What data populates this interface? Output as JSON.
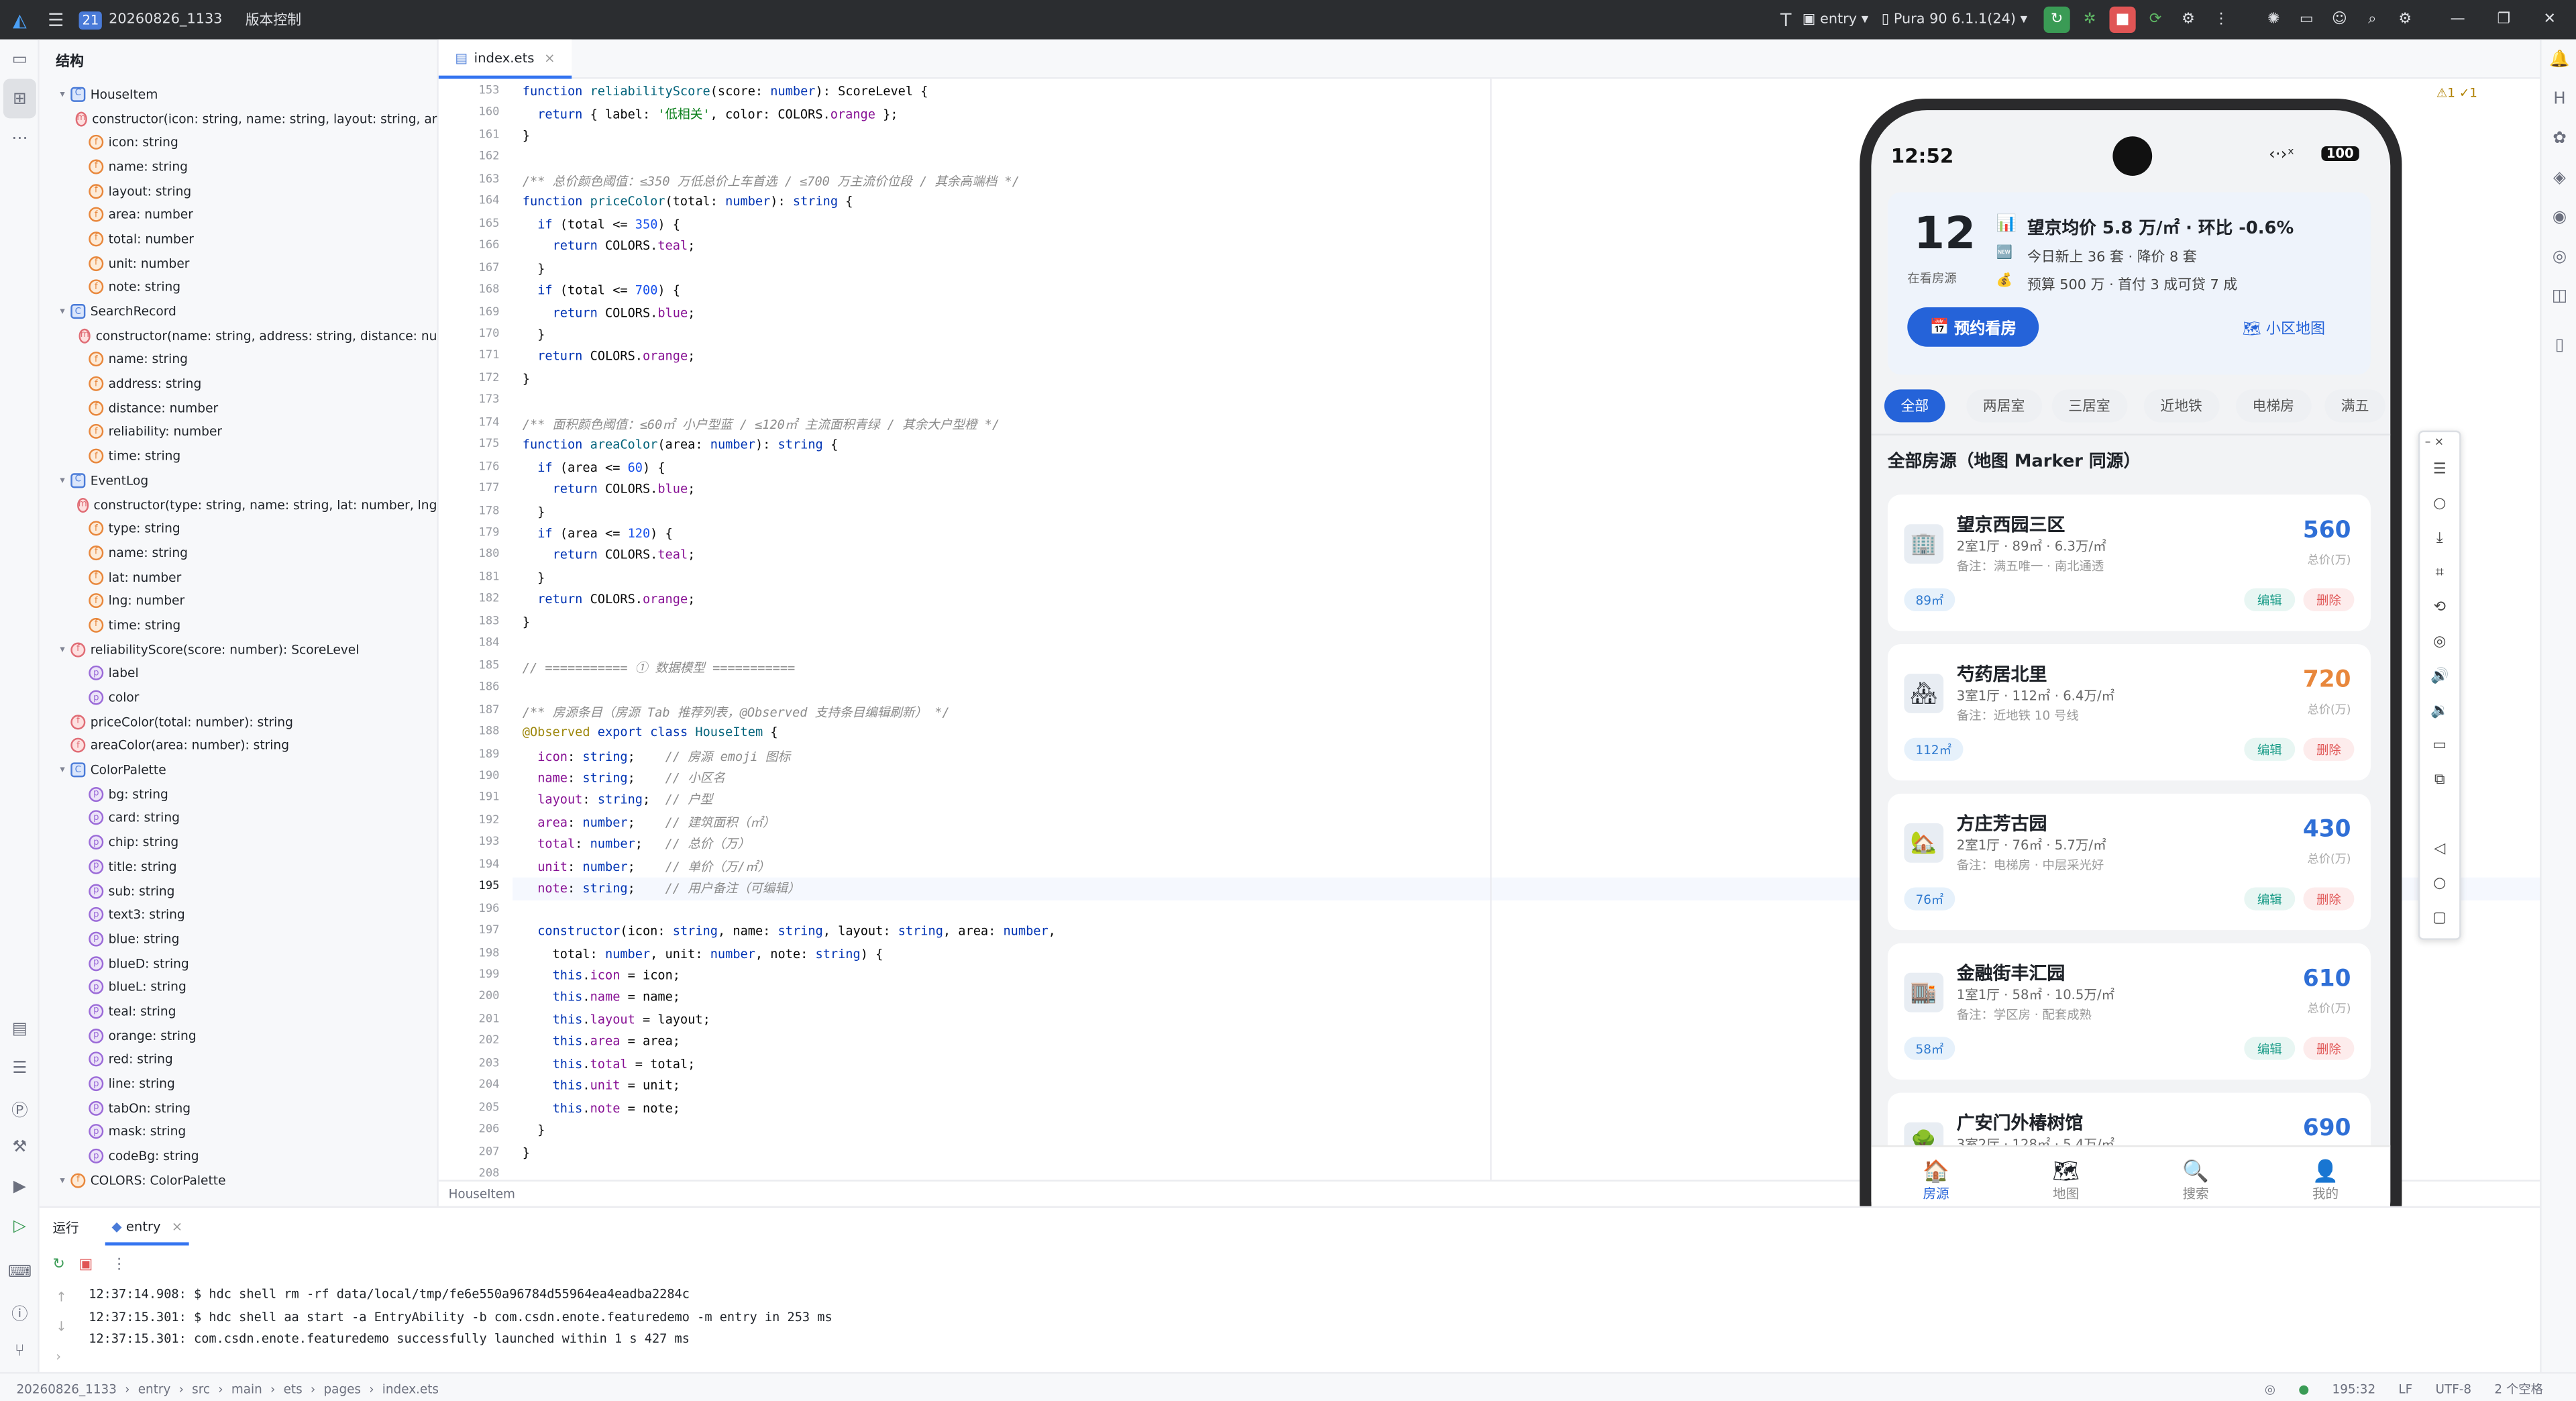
{
  "titlebar": {
    "project_badge": "21",
    "project_name": "20260826_1133",
    "vcs": "版本控制",
    "module": "entry",
    "device": "Pura 90 6.1.1(24)"
  },
  "structure": {
    "title": "结构",
    "items": [
      {
        "indent": 1,
        "twisty": "▾",
        "icon": "c",
        "label": "HouseItem"
      },
      {
        "indent": 2,
        "twisty": "",
        "icon": "m",
        "label": "constructor(icon: string, name: string, layout: string, ar"
      },
      {
        "indent": 2,
        "twisty": "",
        "icon": "f",
        "label": "icon: string"
      },
      {
        "indent": 2,
        "twisty": "",
        "icon": "f",
        "label": "name: string"
      },
      {
        "indent": 2,
        "twisty": "",
        "icon": "f",
        "label": "layout: string"
      },
      {
        "indent": 2,
        "twisty": "",
        "icon": "f",
        "label": "area: number"
      },
      {
        "indent": 2,
        "twisty": "",
        "icon": "f",
        "label": "total: number"
      },
      {
        "indent": 2,
        "twisty": "",
        "icon": "f",
        "label": "unit: number"
      },
      {
        "indent": 2,
        "twisty": "",
        "icon": "f",
        "label": "note: string"
      },
      {
        "indent": 1,
        "twisty": "▾",
        "icon": "c",
        "label": "SearchRecord"
      },
      {
        "indent": 2,
        "twisty": "",
        "icon": "m",
        "label": "constructor(name: string, address: string, distance: nu"
      },
      {
        "indent": 2,
        "twisty": "",
        "icon": "f",
        "label": "name: string"
      },
      {
        "indent": 2,
        "twisty": "",
        "icon": "f",
        "label": "address: string"
      },
      {
        "indent": 2,
        "twisty": "",
        "icon": "f",
        "label": "distance: number"
      },
      {
        "indent": 2,
        "twisty": "",
        "icon": "f",
        "label": "reliability: number"
      },
      {
        "indent": 2,
        "twisty": "",
        "icon": "f",
        "label": "time: string"
      },
      {
        "indent": 1,
        "twisty": "▾",
        "icon": "c",
        "label": "EventLog"
      },
      {
        "indent": 2,
        "twisty": "",
        "icon": "m",
        "label": "constructor(type: string, name: string, lat: number, lng"
      },
      {
        "indent": 2,
        "twisty": "",
        "icon": "f",
        "label": "type: string"
      },
      {
        "indent": 2,
        "twisty": "",
        "icon": "f",
        "label": "name: string"
      },
      {
        "indent": 2,
        "twisty": "",
        "icon": "f",
        "label": "lat: number"
      },
      {
        "indent": 2,
        "twisty": "",
        "icon": "f",
        "label": "lng: number"
      },
      {
        "indent": 2,
        "twisty": "",
        "icon": "f",
        "label": "time: string"
      },
      {
        "indent": 1,
        "twisty": "▾",
        "icon": "fn",
        "label": "reliabilityScore(score: number): ScoreLevel"
      },
      {
        "indent": 2,
        "twisty": "",
        "icon": "p",
        "label": "label"
      },
      {
        "indent": 2,
        "twisty": "",
        "icon": "p",
        "label": "color"
      },
      {
        "indent": 1,
        "twisty": "",
        "icon": "fn",
        "label": "priceColor(total: number): string"
      },
      {
        "indent": 1,
        "twisty": "",
        "icon": "fn",
        "label": "areaColor(area: number): string"
      },
      {
        "indent": 1,
        "twisty": "▾",
        "icon": "c",
        "label": "ColorPalette"
      },
      {
        "indent": 2,
        "twisty": "",
        "icon": "p",
        "label": "bg: string"
      },
      {
        "indent": 2,
        "twisty": "",
        "icon": "p",
        "label": "card: string"
      },
      {
        "indent": 2,
        "twisty": "",
        "icon": "p",
        "label": "chip: string"
      },
      {
        "indent": 2,
        "twisty": "",
        "icon": "p",
        "label": "title: string"
      },
      {
        "indent": 2,
        "twisty": "",
        "icon": "p",
        "label": "sub: string"
      },
      {
        "indent": 2,
        "twisty": "",
        "icon": "p",
        "label": "text3: string"
      },
      {
        "indent": 2,
        "twisty": "",
        "icon": "p",
        "label": "blue: string"
      },
      {
        "indent": 2,
        "twisty": "",
        "icon": "p",
        "label": "blueD: string"
      },
      {
        "indent": 2,
        "twisty": "",
        "icon": "p",
        "label": "blueL: string"
      },
      {
        "indent": 2,
        "twisty": "",
        "icon": "p",
        "label": "teal: string"
      },
      {
        "indent": 2,
        "twisty": "",
        "icon": "p",
        "label": "orange: string"
      },
      {
        "indent": 2,
        "twisty": "",
        "icon": "p",
        "label": "red: string"
      },
      {
        "indent": 2,
        "twisty": "",
        "icon": "p",
        "label": "line: string"
      },
      {
        "indent": 2,
        "twisty": "",
        "icon": "p",
        "label": "tabOn: string"
      },
      {
        "indent": 2,
        "twisty": "",
        "icon": "p",
        "label": "mask: string"
      },
      {
        "indent": 2,
        "twisty": "",
        "icon": "p",
        "label": "codeBg: string"
      },
      {
        "indent": 1,
        "twisty": "▾",
        "icon": "f",
        "label": "COLORS: ColorPalette"
      }
    ]
  },
  "editor": {
    "tab": "index.ets",
    "breadcrumb": "HouseItem",
    "inspection": "⚠1 ✓1",
    "current_line": "195",
    "lines": [
      {
        "n": "153",
        "html": "<span class='kw'>function</span> <span class='fn'>reliabilityScore</span>(score: <span class='ty'>number</span>): ScoreLevel {"
      },
      {
        "n": "160",
        "html": "  <span class='kw'>return</span> { label: <span class='st'>'低相关'</span>, color: COLORS.<span class='pr'>orange</span> };"
      },
      {
        "n": "161",
        "html": "}"
      },
      {
        "n": "162",
        "html": ""
      },
      {
        "n": "163",
        "html": "<span class='cm'>/** 总价颜色阈值：≤350 万低总价上车首选 / ≤700 万主流价位段 / 其余高端档 */</span>"
      },
      {
        "n": "164",
        "html": "<span class='kw'>function</span> <span class='fn'>priceColor</span>(total: <span class='ty'>number</span>): <span class='ty'>string</span> {"
      },
      {
        "n": "165",
        "html": "  <span class='kw'>if</span> (total &lt;= <span class='nm'>350</span>) {"
      },
      {
        "n": "166",
        "html": "    <span class='kw'>return</span> COLORS.<span class='pr'>teal</span>;"
      },
      {
        "n": "167",
        "html": "  }"
      },
      {
        "n": "168",
        "html": "  <span class='kw'>if</span> (total &lt;= <span class='nm'>700</span>) {"
      },
      {
        "n": "169",
        "html": "    <span class='kw'>return</span> COLORS.<span class='pr'>blue</span>;"
      },
      {
        "n": "170",
        "html": "  }"
      },
      {
        "n": "171",
        "html": "  <span class='kw'>return</span> COLORS.<span class='pr'>orange</span>;"
      },
      {
        "n": "172",
        "html": "}"
      },
      {
        "n": "173",
        "html": ""
      },
      {
        "n": "174",
        "html": "<span class='cm'>/** 面积颜色阈值：≤60㎡ 小户型蓝 / ≤120㎡ 主流面积青绿 / 其余大户型橙 */</span>"
      },
      {
        "n": "175",
        "html": "<span class='kw'>function</span> <span class='fn'>areaColor</span>(area: <span class='ty'>number</span>): <span class='ty'>string</span> {"
      },
      {
        "n": "176",
        "html": "  <span class='kw'>if</span> (area &lt;= <span class='nm'>60</span>) {"
      },
      {
        "n": "177",
        "html": "    <span class='kw'>return</span> COLORS.<span class='pr'>blue</span>;"
      },
      {
        "n": "178",
        "html": "  }"
      },
      {
        "n": "179",
        "html": "  <span class='kw'>if</span> (area &lt;= <span class='nm'>120</span>) {"
      },
      {
        "n": "180",
        "html": "    <span class='kw'>return</span> COLORS.<span class='pr'>teal</span>;"
      },
      {
        "n": "181",
        "html": "  }"
      },
      {
        "n": "182",
        "html": "  <span class='kw'>return</span> COLORS.<span class='pr'>orange</span>;"
      },
      {
        "n": "183",
        "html": "}"
      },
      {
        "n": "184",
        "html": ""
      },
      {
        "n": "185",
        "html": "<span class='cm'>// =========== ① 数据模型 ===========</span>"
      },
      {
        "n": "186",
        "html": ""
      },
      {
        "n": "187",
        "html": "<span class='cm'>/** 房源条目（房源 Tab 推荐列表，@Observed 支持条目编辑刷新） */</span>"
      },
      {
        "n": "188",
        "html": "<span class='an'>@Observed</span> <span class='kw'>export class</span> <span class='fn'>HouseItem</span> {"
      },
      {
        "n": "189",
        "html": "  <span class='pr'>icon</span>: <span class='ty'>string</span>;    <span class='cm'>// 房源 emoji 图标</span>"
      },
      {
        "n": "190",
        "html": "  <span class='pr'>name</span>: <span class='ty'>string</span>;    <span class='cm'>// 小区名</span>"
      },
      {
        "n": "191",
        "html": "  <span class='pr'>layout</span>: <span class='ty'>string</span>;  <span class='cm'>// 户型</span>"
      },
      {
        "n": "192",
        "html": "  <span class='pr'>area</span>: <span class='ty'>number</span>;    <span class='cm'>// 建筑面积（㎡）</span>"
      },
      {
        "n": "193",
        "html": "  <span class='pr'>total</span>: <span class='ty'>number</span>;   <span class='cm'>// 总价（万）</span>"
      },
      {
        "n": "194",
        "html": "  <span class='pr'>unit</span>: <span class='ty'>number</span>;    <span class='cm'>// 单价（万/㎡）</span>"
      },
      {
        "n": "195",
        "html": "  <span class='pr'>note</span>: <span class='ty'>string</span>;    <span class='cm'>// 用户备注（可编辑）</span>"
      },
      {
        "n": "196",
        "html": ""
      },
      {
        "n": "197",
        "html": "  <span class='kw'>constructor</span>(icon: <span class='ty'>string</span>, name: <span class='ty'>string</span>, layout: <span class='ty'>string</span>, area: <span class='ty'>number</span>,"
      },
      {
        "n": "198",
        "html": "    total: <span class='ty'>number</span>, unit: <span class='ty'>number</span>, note: <span class='ty'>string</span>) {"
      },
      {
        "n": "199",
        "html": "    <span class='kw'>this</span>.<span class='pr'>icon</span> = icon;"
      },
      {
        "n": "200",
        "html": "    <span class='kw'>this</span>.<span class='pr'>name</span> = name;"
      },
      {
        "n": "201",
        "html": "    <span class='kw'>this</span>.<span class='pr'>layout</span> = layout;"
      },
      {
        "n": "202",
        "html": "    <span class='kw'>this</span>.<span class='pr'>area</span> = area;"
      },
      {
        "n": "203",
        "html": "    <span class='kw'>this</span>.<span class='pr'>total</span> = total;"
      },
      {
        "n": "204",
        "html": "    <span class='kw'>this</span>.<span class='pr'>unit</span> = unit;"
      },
      {
        "n": "205",
        "html": "    <span class='kw'>this</span>.<span class='pr'>note</span> = note;"
      },
      {
        "n": "206",
        "html": "  }"
      },
      {
        "n": "207",
        "html": "}"
      },
      {
        "n": "208",
        "html": ""
      }
    ]
  },
  "phone": {
    "time": "12:52",
    "battery": "100",
    "hero": {
      "count": "12",
      "count_label": "在看房源",
      "line1": "望京均价 5.8 万/㎡ · 环比 -0.6%",
      "line2": "今日新上 36 套 · 降价 8 套",
      "line3": "预算 500 万 · 首付 3 成可贷 7 成",
      "cta": "预约看房",
      "map_link": "小区地图"
    },
    "chips": [
      "全部",
      "两居室",
      "三居室",
      "近地铁",
      "电梯房",
      "满五"
    ],
    "section_title": "全部房源（地图 Marker 同源）",
    "houses": [
      {
        "icon": "🏢",
        "name": "望京西园三区",
        "meta": "2室1厅 · 89㎡ · 6.3万/㎡",
        "note": "备注：满五唯一 · 南北通透",
        "price": "560",
        "unit": "总价(万)",
        "tag": "89㎡",
        "price_color": "#2f6fd6",
        "edit": "编辑",
        "del": "删除"
      },
      {
        "icon": "🏘",
        "name": "芍药居北里",
        "meta": "3室1厅 · 112㎡ · 6.4万/㎡",
        "note": "备注：近地铁 10 号线",
        "price": "720",
        "unit": "总价(万)",
        "tag": "112㎡",
        "price_color": "#e8873c",
        "edit": "编辑",
        "del": "删除"
      },
      {
        "icon": "🏡",
        "name": "方庄芳古园",
        "meta": "2室1厅 · 76㎡ · 5.7万/㎡",
        "note": "备注：电梯房 · 中层采光好",
        "price": "430",
        "unit": "总价(万)",
        "tag": "76㎡",
        "price_color": "#2f6fd6",
        "edit": "编辑",
        "del": "删除"
      },
      {
        "icon": "🏬",
        "name": "金融街丰汇园",
        "meta": "1室1厅 · 58㎡ · 10.5万/㎡",
        "note": "备注：学区房 · 配套成熟",
        "price": "610",
        "unit": "总价(万)",
        "tag": "58㎡",
        "price_color": "#2f6fd6",
        "edit": "编辑",
        "del": "删除"
      },
      {
        "icon": "🌳",
        "name": "广安门外椿树馆",
        "meta": "3室2厅 · 128㎡ · 5.4万/㎡",
        "note": "",
        "price": "690",
        "unit": "",
        "tag": "",
        "price_color": "#2f6fd6",
        "edit": "",
        "del": ""
      }
    ],
    "tabs": [
      {
        "icon": "🏠",
        "label": "房源",
        "active": true
      },
      {
        "icon": "🗺",
        "label": "地图",
        "active": false
      },
      {
        "icon": "🔍",
        "label": "搜索",
        "active": false
      },
      {
        "icon": "👤",
        "label": "我的",
        "active": false
      }
    ]
  },
  "run": {
    "tab_title": "运行",
    "config": "entry",
    "console": [
      "12:37:14.908: $ hdc shell rm -rf data/local/tmp/fe6e550a96784d55964ea4eadba2284c",
      "12:37:15.301: $ hdc shell aa start -a EntryAbility -b com.csdn.enote.featuredemo -m entry in 253 ms",
      "12:37:15.301: com.csdn.enote.featuredemo successfully launched within 1 s 427 ms"
    ]
  },
  "statusbar": {
    "path": [
      "20260826_1133",
      "entry",
      "src",
      "main",
      "ets",
      "pages",
      "index.ets"
    ],
    "position": "195:32",
    "line_sep": "LF",
    "encoding": "UTF-8",
    "indent": "2 个空格"
  }
}
